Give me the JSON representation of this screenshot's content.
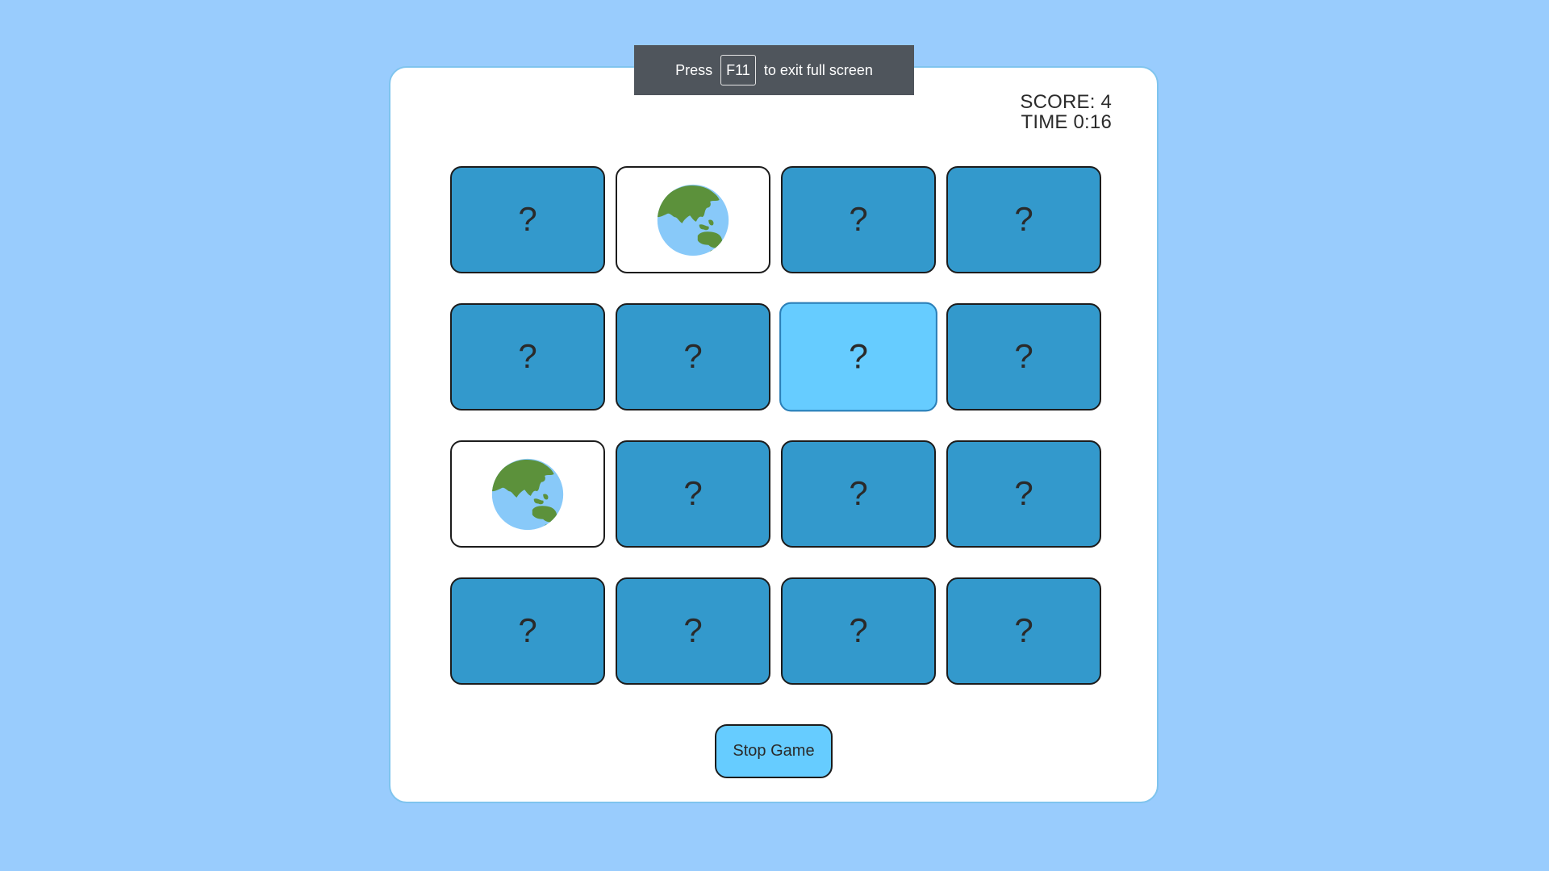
{
  "fullscreen_toast": {
    "press": "Press",
    "key": "F11",
    "message": "to exit full screen"
  },
  "stats": {
    "score": "SCORE: 4",
    "time": "TIME 0:16"
  },
  "cards": [
    {
      "state": "hidden",
      "label": "?"
    },
    {
      "state": "revealed",
      "label": "",
      "icon": "globe-asia-australia-icon"
    },
    {
      "state": "hidden",
      "label": "?"
    },
    {
      "state": "hidden",
      "label": "?"
    },
    {
      "state": "hidden",
      "label": "?"
    },
    {
      "state": "hidden",
      "label": "?"
    },
    {
      "state": "hover",
      "label": "?"
    },
    {
      "state": "hidden",
      "label": "?"
    },
    {
      "state": "revealed",
      "label": "",
      "icon": "globe-asia-australia-icon"
    },
    {
      "state": "hidden",
      "label": "?"
    },
    {
      "state": "hidden",
      "label": "?"
    },
    {
      "state": "hidden",
      "label": "?"
    },
    {
      "state": "hidden",
      "label": "?"
    },
    {
      "state": "hidden",
      "label": "?"
    },
    {
      "state": "hidden",
      "label": "?"
    },
    {
      "state": "hidden",
      "label": "?"
    }
  ],
  "controls": {
    "stop_label": "Stop Game"
  },
  "colors": {
    "page_bg": "#99ccfd",
    "card_hidden": "#3399cc",
    "card_hover": "#66ccff",
    "card_revealed": "#ffffff",
    "button_bg": "#66ccff",
    "toast_bg": "#4f555c"
  }
}
